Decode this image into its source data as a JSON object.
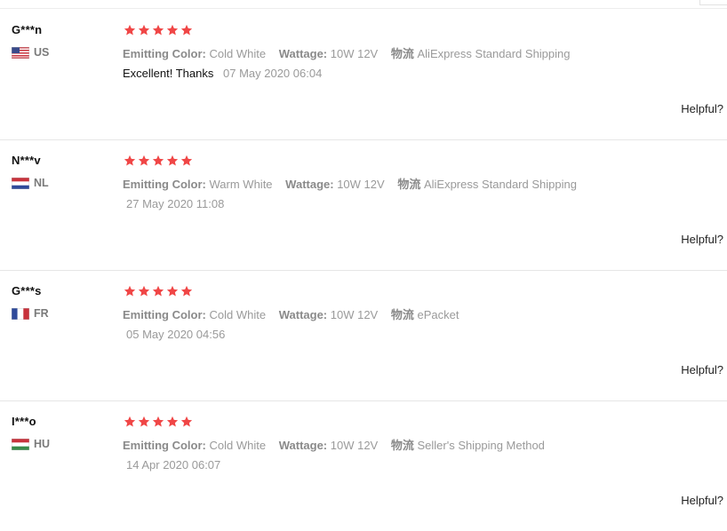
{
  "attr_labels": {
    "color": "Emitting Color:",
    "wattage": "Wattage:",
    "shipping": "物流"
  },
  "helpful_label": "Helpful?",
  "reviews": [
    {
      "user": "G***n",
      "country": "US",
      "rating": 5,
      "color": "Cold White",
      "wattage": "10W 12V",
      "shipping": "AliExpress Standard Shipping",
      "text": "Excellent! Thanks",
      "date": "07 May 2020 06:04"
    },
    {
      "user": "N***v",
      "country": "NL",
      "rating": 5,
      "color": "Warm White",
      "wattage": "10W 12V",
      "shipping": "AliExpress Standard Shipping",
      "text": "",
      "date": "27 May 2020 11:08"
    },
    {
      "user": "G***s",
      "country": "FR",
      "rating": 5,
      "color": "Cold White",
      "wattage": "10W 12V",
      "shipping": "ePacket",
      "text": "",
      "date": "05 May 2020 04:56"
    },
    {
      "user": "I***o",
      "country": "HU",
      "rating": 5,
      "color": "Cold White",
      "wattage": "10W 12V",
      "shipping": "Seller's Shipping Method",
      "text": "",
      "date": "14 Apr 2020 06:07"
    }
  ],
  "colors": {
    "star": "#f04646",
    "attr_label": "#8a8a8a",
    "muted": "#9a9a9a"
  },
  "icons": {
    "star": "star-icon",
    "flags": [
      "us-flag-icon",
      "nl-flag-icon",
      "fr-flag-icon",
      "hu-flag-icon"
    ]
  }
}
